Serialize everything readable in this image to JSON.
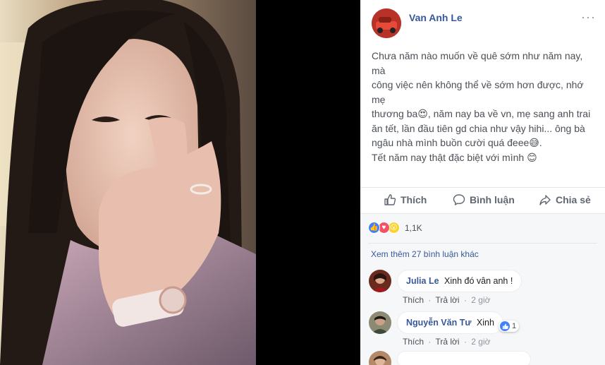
{
  "post": {
    "author": "Van Anh Le",
    "more_label": "···",
    "text_lines": [
      "Chưa năm nào muốn về quê sớm như năm nay, mà",
      "công việc nên không thể về sớm hơn được, nhớ mẹ",
      "thương ba😍, năm nay ba về vn, mẹ sang anh trai",
      "ăn tết, lần đầu tiên gd chia như vậy hihi... ông bà",
      "ngâu nhà mình buồn cười quá đeee😅.",
      "Tết năm nay thật đặc biệt với mình 😊"
    ]
  },
  "actions": {
    "like": "Thích",
    "comment": "Bình luận",
    "share": "Chia sẻ"
  },
  "reactions": {
    "count": "1,1K",
    "types": [
      "like",
      "love",
      "wow"
    ]
  },
  "comments_section": {
    "see_more": "Xem thêm 27 bình luận khác",
    "comments": [
      {
        "name": "Julia Le",
        "text": "Xinh đó vân anh !",
        "like": "Thích",
        "reply": "Trả lời",
        "time": "2 giờ",
        "likes": ""
      },
      {
        "name": "Nguyễn Văn Tư",
        "text": "Xinh",
        "like": "Thích",
        "reply": "Trả lời",
        "time": "2 giờ",
        "likes": "1"
      }
    ]
  },
  "colors": {
    "name_link": "#385898",
    "like_blue": "#4080ff",
    "love_red": "#f25268",
    "wow_yellow": "#fcd12a"
  }
}
